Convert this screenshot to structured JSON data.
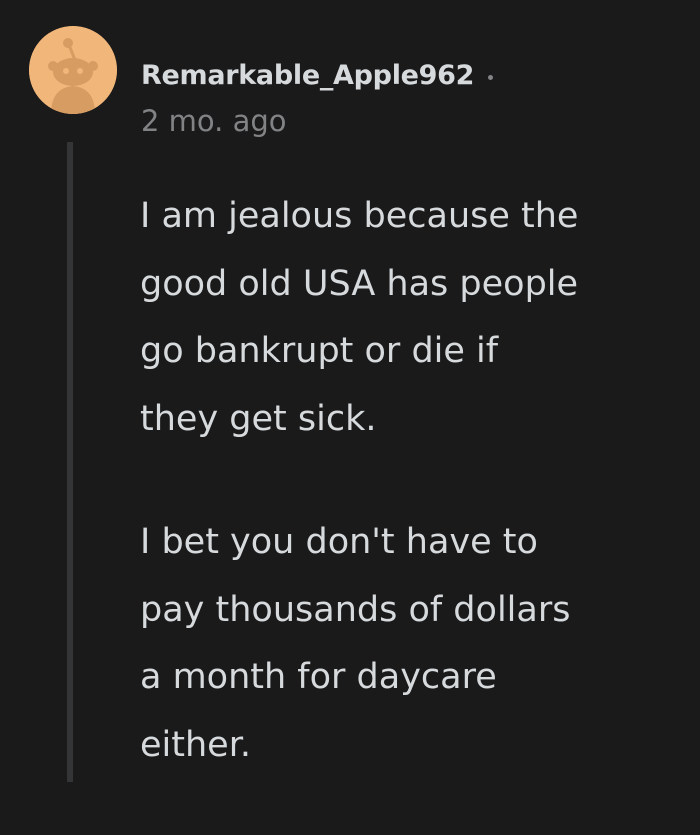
{
  "comment": {
    "author": "Remarkable_Apple962",
    "timestamp": "2 mo. ago",
    "avatar_icon": "snoo-avatar-icon",
    "colors": {
      "background": "#1a1a1b",
      "text": "#d7dadc",
      "meta": "#818384",
      "avatar_bg": "#f1b67a"
    },
    "paragraphs": [
      "I am jealous because the\ngood old USA has people\ngo bankrupt or die if\nthey get sick.",
      "I bet you don't have to\npay thousands of dollars\na month for daycare\neither."
    ]
  }
}
